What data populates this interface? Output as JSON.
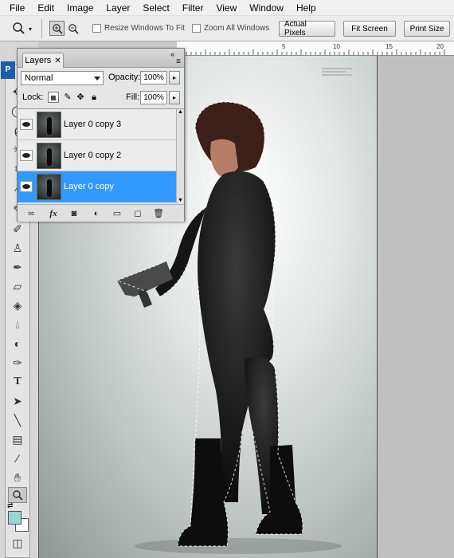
{
  "menu": [
    "File",
    "Edit",
    "Image",
    "Layer",
    "Select",
    "Filter",
    "View",
    "Window",
    "Help"
  ],
  "options_bar": {
    "resize_windows_label": "Resize Windows To Fit",
    "zoom_all_label": "Zoom All Windows",
    "actual_pixels_label": "Actual Pixels",
    "fit_screen_label": "Fit Screen",
    "print_size_label": "Print Size",
    "resize_checked": false,
    "zoom_all_checked": false
  },
  "ruler_numbers": [
    "5",
    "10",
    "15",
    "20"
  ],
  "layers_panel": {
    "tab_label": "Layers",
    "blend_mode": "Normal",
    "opacity_label": "Opacity:",
    "opacity_value": "100%",
    "lock_label": "Lock:",
    "fill_label": "Fill:",
    "fill_value": "100%",
    "layers": [
      {
        "name": "Layer 0 copy 3",
        "visible": true,
        "selected": false
      },
      {
        "name": "Layer 0 copy 2",
        "visible": true,
        "selected": false
      },
      {
        "name": "Layer 0 copy",
        "visible": true,
        "selected": true
      }
    ]
  },
  "colors": {
    "selection_blue": "#3399ff",
    "foreground": "#000000",
    "background": "#99d6d6"
  }
}
